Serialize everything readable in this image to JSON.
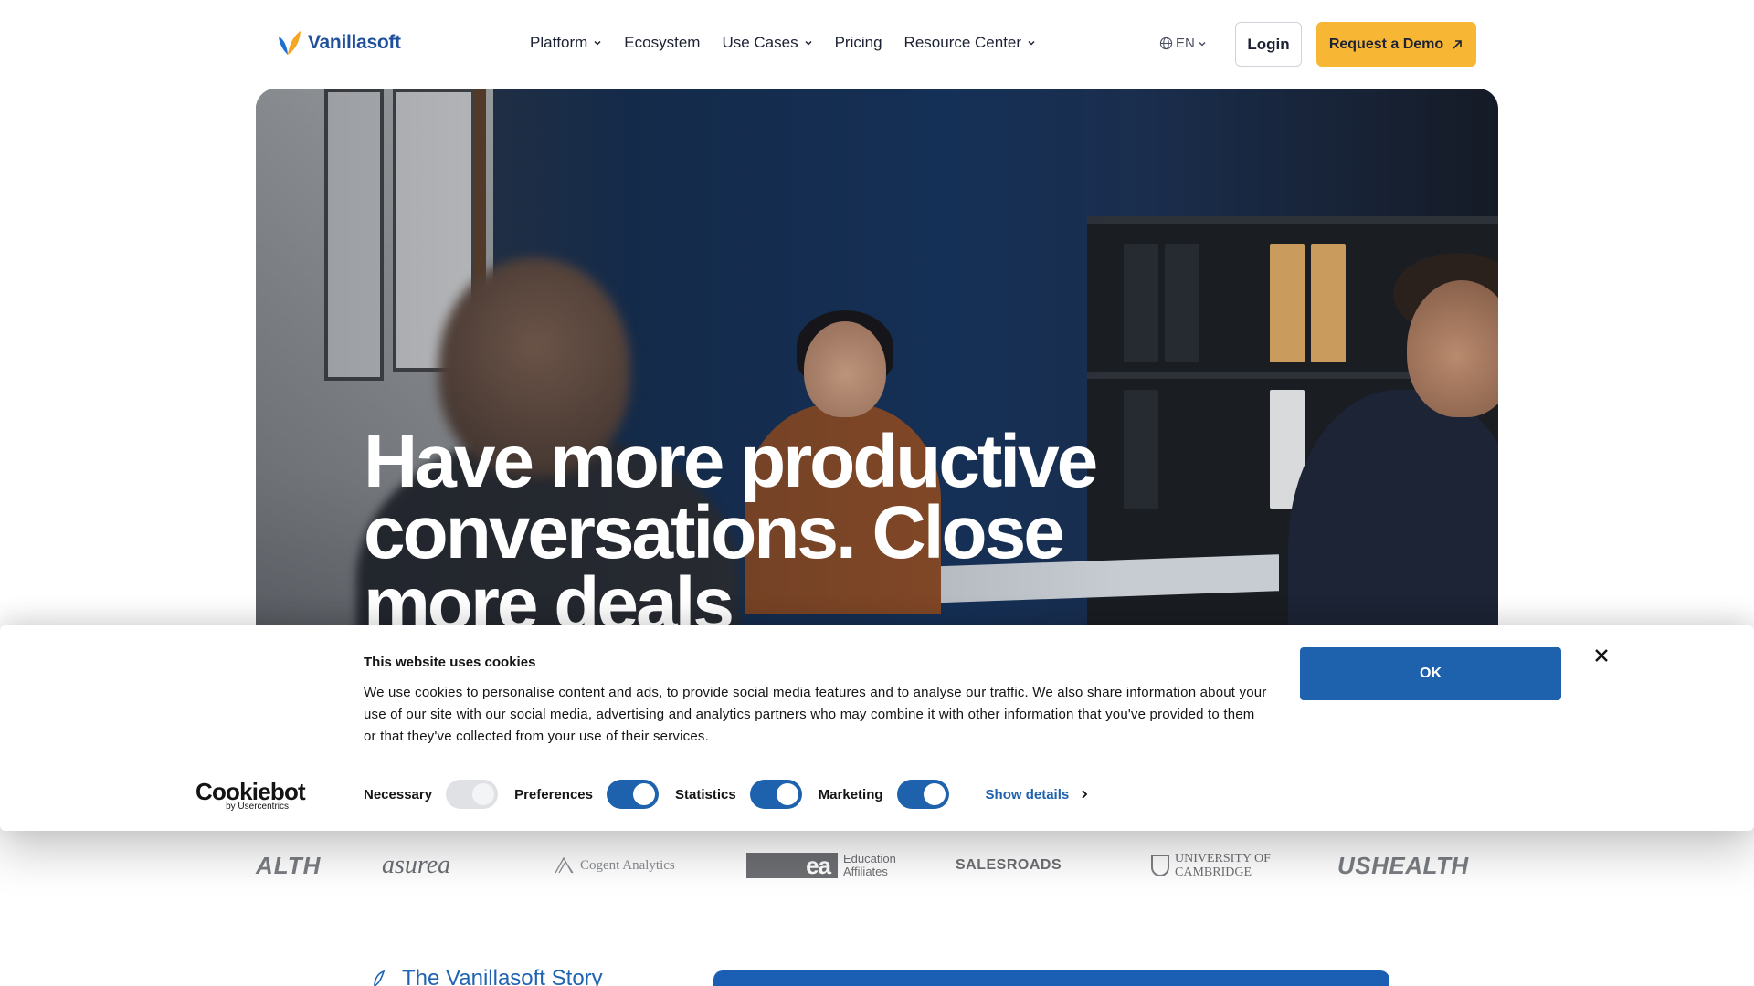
{
  "header": {
    "logo_text": "Vanillasoft",
    "nav": [
      {
        "label": "Platform",
        "dropdown": true
      },
      {
        "label": "Ecosystem",
        "dropdown": false
      },
      {
        "label": "Use Cases",
        "dropdown": true
      },
      {
        "label": "Pricing",
        "dropdown": false
      },
      {
        "label": "Resource Center",
        "dropdown": true
      }
    ],
    "language": "EN",
    "login_label": "Login",
    "demo_label": "Request a Demo"
  },
  "hero": {
    "title": "Have more productive conversations. Close more deals"
  },
  "clients": {
    "alth": "ALTH",
    "asurea": "asurea",
    "cogent": "Cogent Analytics",
    "ea_mark": "ea",
    "ea_line1": "Education",
    "ea_line2": "Affiliates",
    "salesroads": "SALESROADS",
    "cambridge_line1": "UNIVERSITY OF",
    "cambridge_line2": "CAMBRIDGE",
    "ushealth": "USHEALTH"
  },
  "story": {
    "title": "The Vanillasoft Story"
  },
  "cookie_banner": {
    "brand": "Cookiebot",
    "brand_sub": "by Usercentrics",
    "title": "This website uses cookies",
    "text": "We use cookies to personalise content and ads, to provide social media features and to analyse our traffic. We also share information about your use of our site with our social media, advertising and analytics partners who may combine it with other information that you've provided to them or that they've collected from your use of their services.",
    "consents": [
      {
        "label": "Necessary",
        "enabled": true,
        "locked": true
      },
      {
        "label": "Preferences",
        "enabled": true,
        "locked": false
      },
      {
        "label": "Statistics",
        "enabled": true,
        "locked": false
      },
      {
        "label": "Marketing",
        "enabled": true,
        "locked": false
      }
    ],
    "show_details_label": "Show details",
    "ok_label": "OK"
  },
  "colors": {
    "brand_blue": "#1f4f9a",
    "demo_yellow": "#f7b634",
    "cookie_blue": "#1e62ad"
  }
}
